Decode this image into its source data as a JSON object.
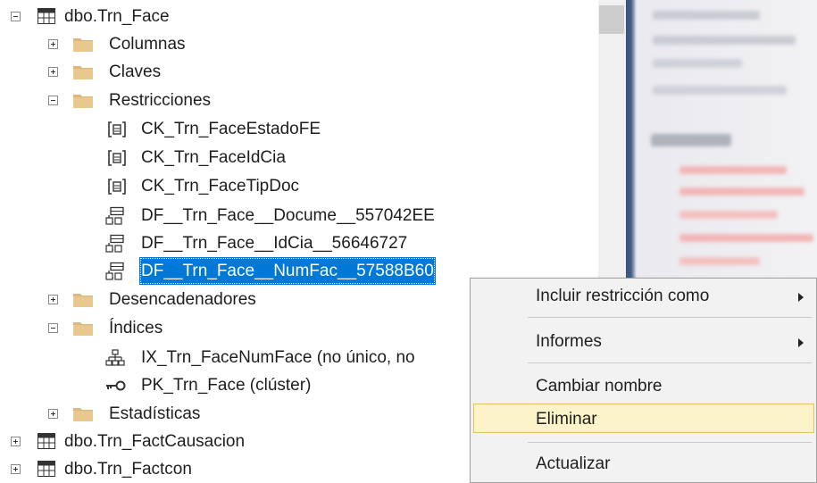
{
  "tree": {
    "items": [
      {
        "id": "trn-face",
        "label": "dbo.Trn_Face"
      },
      {
        "id": "columnas",
        "label": "Columnas"
      },
      {
        "id": "claves",
        "label": "Claves"
      },
      {
        "id": "restricciones",
        "label": "Restricciones"
      },
      {
        "id": "ck-estado",
        "label": "CK_Trn_FaceEstadoFE"
      },
      {
        "id": "ck-idcia",
        "label": "CK_Trn_FaceIdCia"
      },
      {
        "id": "ck-tipdoc",
        "label": "CK_Trn_FaceTipDoc"
      },
      {
        "id": "df-docume",
        "label": "DF__Trn_Face__Docume__557042EE"
      },
      {
        "id": "df-idcia",
        "label": "DF__Trn_Face__IdCia__56646727"
      },
      {
        "id": "df-numfac",
        "label": "DF__Trn_Face__NumFac__57588B60"
      },
      {
        "id": "desencadenadores",
        "label": "Desencadenadores"
      },
      {
        "id": "indices",
        "label": "Índices"
      },
      {
        "id": "ix-numface",
        "label": "IX_Trn_FaceNumFace (no único, no"
      },
      {
        "id": "pk-face",
        "label": "PK_Trn_Face (clúster)"
      },
      {
        "id": "estadisticas",
        "label": "Estadísticas"
      },
      {
        "id": "trn-factcausacion",
        "label": "dbo.Trn_FactCausacion"
      },
      {
        "id": "trn-factcon",
        "label": "dbo.Trn_Factcon"
      }
    ]
  },
  "context_menu": {
    "items": [
      {
        "label": "Incluir restricción como",
        "submenu": true
      },
      {
        "label": "Informes",
        "submenu": true
      },
      {
        "label": "Cambiar nombre",
        "submenu": false
      },
      {
        "label": "Eliminar",
        "submenu": false,
        "hovered": true
      },
      {
        "label": "Actualizar",
        "submenu": false
      }
    ]
  },
  "colors": {
    "selection": "#0078d7",
    "menu_hover": "#fcf3c8",
    "menu_hover_border": "#e5c365",
    "folder": "#dcb67a"
  },
  "icons": {
    "table": "table-icon",
    "folder": "folder-icon",
    "check": "check-constraint-icon",
    "default": "default-constraint-icon",
    "index": "index-icon",
    "key": "key-icon"
  }
}
